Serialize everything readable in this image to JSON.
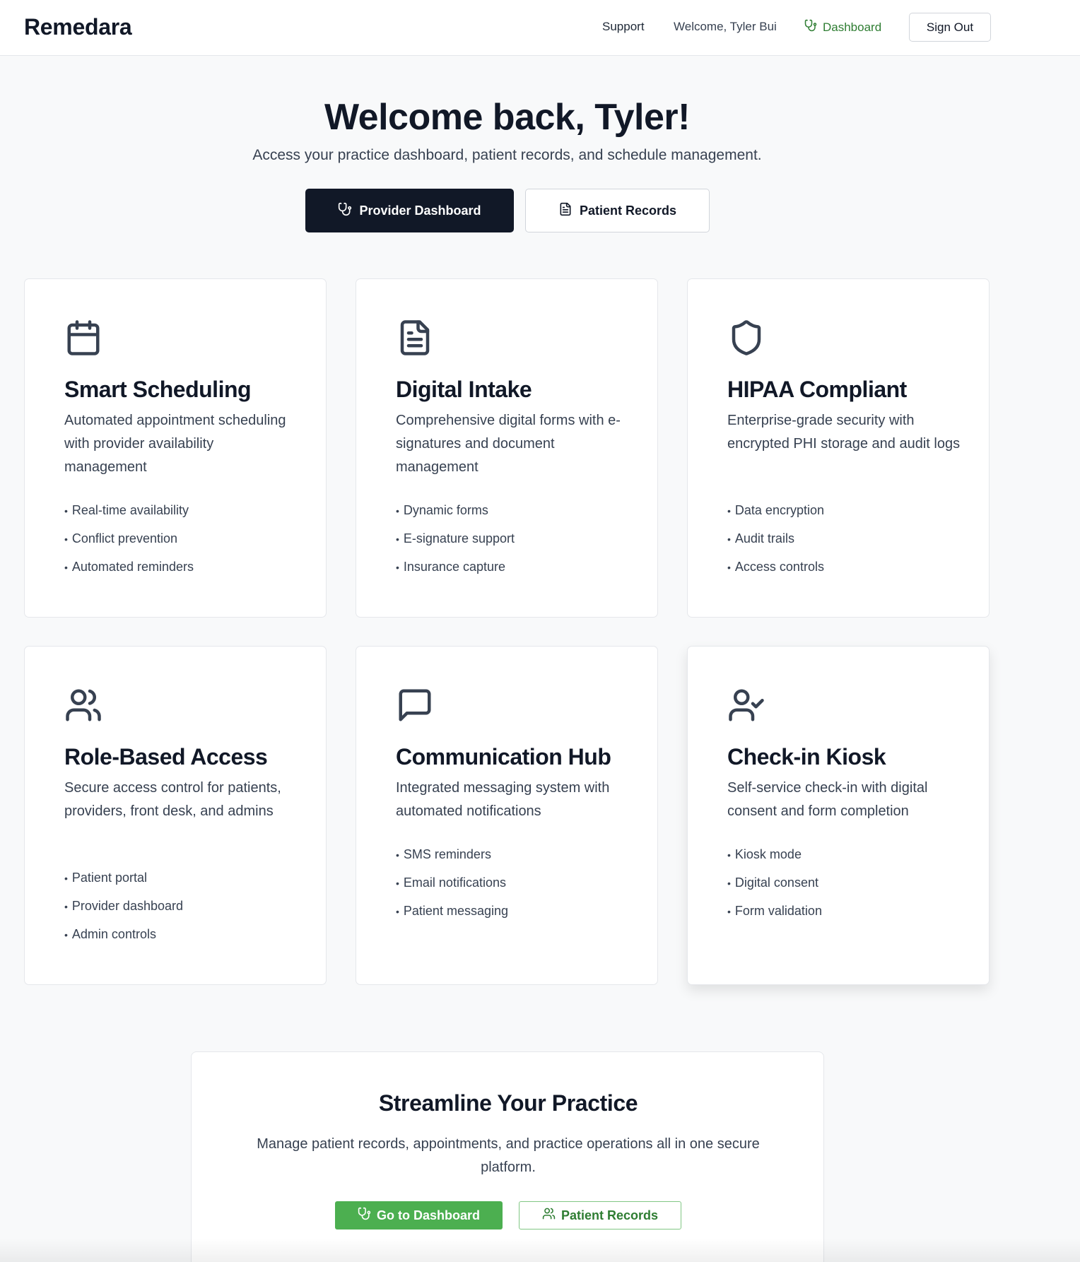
{
  "header": {
    "brand": "Remedara",
    "support": "Support",
    "welcome": "Welcome, Tyler Bui",
    "dashboard": "Dashboard",
    "sign_out": "Sign Out"
  },
  "hero": {
    "title": "Welcome back, Tyler!",
    "subtitle": "Access your practice dashboard, patient records, and schedule management.",
    "primary_button": "Provider Dashboard",
    "secondary_button": "Patient Records"
  },
  "features": [
    {
      "icon": "calendar-icon",
      "title": "Smart Scheduling",
      "description": "Automated appointment scheduling with provider availability management",
      "bullets": [
        "Real-time availability",
        "Conflict prevention",
        "Automated reminders"
      ]
    },
    {
      "icon": "document-icon",
      "title": "Digital Intake",
      "description": "Comprehensive digital forms with e-signatures and document management",
      "bullets": [
        "Dynamic forms",
        "E-signature support",
        "Insurance capture"
      ]
    },
    {
      "icon": "shield-icon",
      "title": "HIPAA Compliant",
      "description": "Enterprise-grade security with encrypted PHI storage and audit logs",
      "bullets": [
        "Data encryption",
        "Audit trails",
        "Access controls"
      ]
    },
    {
      "icon": "users-icon",
      "title": "Role-Based Access",
      "description": "Secure access control for patients, providers, front desk, and admins",
      "bullets": [
        "Patient portal",
        "Provider dashboard",
        "Admin controls"
      ]
    },
    {
      "icon": "message-icon",
      "title": "Communication Hub",
      "description": "Integrated messaging system with automated notifications",
      "bullets": [
        "SMS reminders",
        "Email notifications",
        "Patient messaging"
      ]
    },
    {
      "icon": "user-check-icon",
      "title": "Check-in Kiosk",
      "description": "Self-service check-in with digital consent and form completion",
      "bullets": [
        "Kiosk mode",
        "Digital consent",
        "Form validation"
      ]
    }
  ],
  "cta": {
    "title": "Streamline Your Practice",
    "text": "Manage patient records, appointments, and practice operations all in one secure platform.",
    "primary_button": "Go to Dashboard",
    "secondary_button": "Patient Records"
  },
  "colors": {
    "primary_dark": "#111827",
    "accent_green": "#4caf50",
    "green_text": "#2e7d32",
    "background": "#f8f9fa"
  }
}
